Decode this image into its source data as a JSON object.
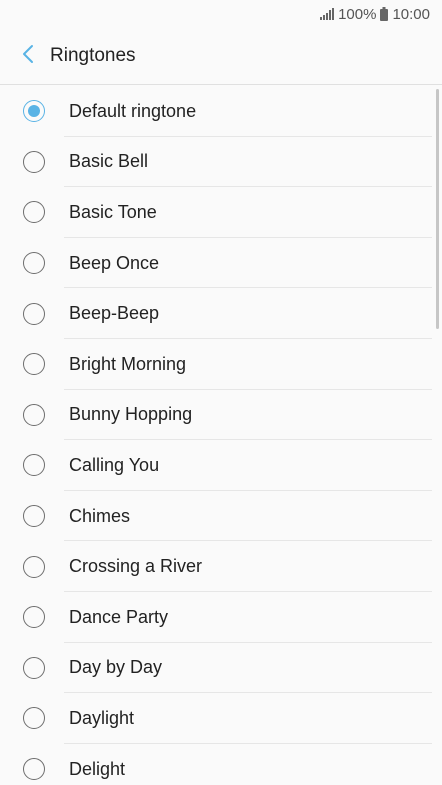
{
  "status": {
    "battery_text": "100%",
    "time": "10:00"
  },
  "header": {
    "title": "Ringtones"
  },
  "ringtones": [
    {
      "label": "Default ringtone",
      "selected": true
    },
    {
      "label": "Basic Bell",
      "selected": false
    },
    {
      "label": "Basic Tone",
      "selected": false
    },
    {
      "label": "Beep Once",
      "selected": false
    },
    {
      "label": "Beep-Beep",
      "selected": false
    },
    {
      "label": "Bright Morning",
      "selected": false
    },
    {
      "label": "Bunny Hopping",
      "selected": false
    },
    {
      "label": "Calling You",
      "selected": false
    },
    {
      "label": "Chimes",
      "selected": false
    },
    {
      "label": "Crossing a River",
      "selected": false
    },
    {
      "label": "Dance Party",
      "selected": false
    },
    {
      "label": "Day by Day",
      "selected": false
    },
    {
      "label": "Daylight",
      "selected": false
    },
    {
      "label": "Delight",
      "selected": false
    }
  ],
  "colors": {
    "accent": "#59b3e5",
    "background": "#fafafa"
  }
}
